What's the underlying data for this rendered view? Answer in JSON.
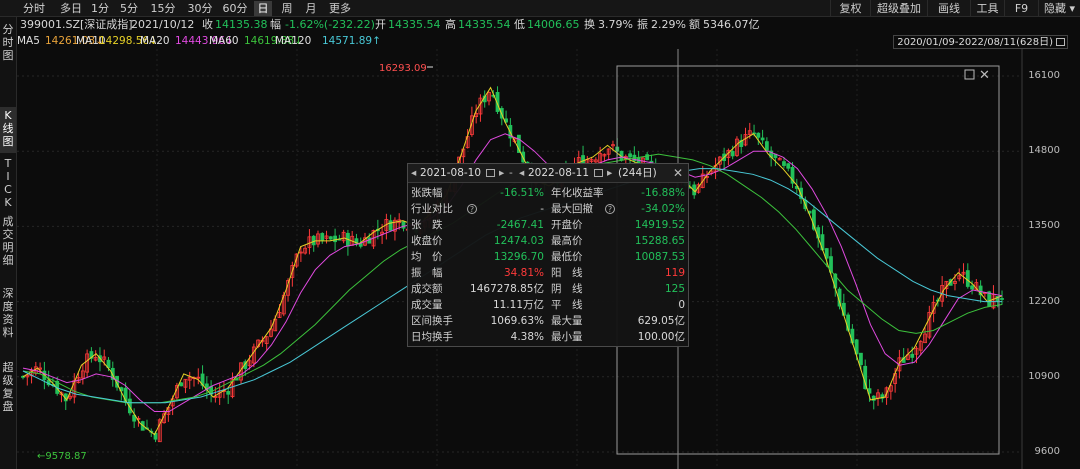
{
  "toolbar": {
    "timeframes": [
      "分时",
      "多日",
      "1分",
      "5分",
      "15分",
      "30分",
      "60分",
      "日",
      "周",
      "月",
      "更多"
    ],
    "active_index": 7,
    "right_buttons": [
      "复权",
      "超级叠加",
      "画线",
      "工具",
      "F9",
      "隐藏"
    ]
  },
  "quote": {
    "code": "399001.SZ[深证成指]",
    "date": "2021/10/12",
    "close_label": "收",
    "close": "14135.38",
    "change_label": "幅",
    "change": "-1.62%(-232.22)",
    "open_label": "开",
    "open": "14335.54",
    "high_label": "高",
    "high": "14335.54",
    "low_label": "低",
    "low": "14006.65",
    "turnover_label": "换",
    "turnover": "3.79%",
    "amplitude_label": "振",
    "amplitude": "2.29%",
    "amount_label": "额",
    "amount": "5346.07亿"
  },
  "left_tabs": [
    "分时图",
    "K线图",
    "TICK",
    "成交明细",
    "深度资料",
    "超级复盘"
  ],
  "left_tab_active": 1,
  "ma": [
    {
      "label": "MA5",
      "value": "14261.03↓",
      "color": "#ffffff",
      "vcolor": "#e8a33a"
    },
    {
      "label": "MA10",
      "value": "14298.56↓",
      "color": "#ffffff",
      "vcolor": "#e6d127"
    },
    {
      "label": "MA20",
      "value": "14443.96↓",
      "color": "#ffffff",
      "vcolor": "#e04ae0"
    },
    {
      "label": "MA60",
      "value": "14619.88↓",
      "color": "#ffffff",
      "vcolor": "#3cc23c"
    },
    {
      "label": "MA120",
      "value": "14571.89↑",
      "color": "#ffffff",
      "vcolor": "#49c8d6"
    }
  ],
  "date_range": "2020/01/09-2022/08/11(628日)",
  "y_axis": [
    "16100",
    "14800",
    "13500",
    "12200",
    "10900",
    "9600"
  ],
  "chart_labels": {
    "high": "16293.09",
    "low": "9578.87"
  },
  "popup": {
    "start": "2021-08-10",
    "end": "2022-08-11",
    "days": "(244日)",
    "rows": [
      {
        "l1": "张跌幅",
        "v1": "-16.51%",
        "c1": "g",
        "l2": "年化收益率",
        "v2": "-16.88%",
        "c2": "g"
      },
      {
        "l1": "行业对比",
        "v1": "-",
        "c1": "w",
        "l2": "最大回撤",
        "v2": "-34.02%",
        "c2": "g"
      },
      {
        "l1": "张　跌",
        "v1": "-2467.41",
        "c1": "g",
        "l2": "开盘价",
        "v2": "14919.52",
        "c2": "g"
      },
      {
        "l1": "收盘价",
        "v1": "12474.03",
        "c1": "g",
        "l2": "最高价",
        "v2": "15288.65",
        "c2": "g"
      },
      {
        "l1": "均　价",
        "v1": "13296.70",
        "c1": "g",
        "l2": "最低价",
        "v2": "10087.53",
        "c2": "g"
      },
      {
        "l1": "振　幅",
        "v1": "34.81%",
        "c1": "r",
        "l2": "阳　线",
        "v2": "119",
        "c2": "r"
      },
      {
        "l1": "成交额",
        "v1": "1467278.85亿",
        "c1": "w",
        "l2": "阴　线",
        "v2": "125",
        "c2": "g"
      },
      {
        "l1": "成交量",
        "v1": "11.11万亿",
        "c1": "w",
        "l2": "平　线",
        "v2": "0",
        "c2": "w"
      },
      {
        "l1": "区间换手",
        "v1": "1069.63%",
        "c1": "w",
        "l2": "最大量",
        "v2": "629.05亿",
        "c2": "w"
      },
      {
        "l1": "日均换手",
        "v1": "4.38%",
        "c1": "w",
        "l2": "最小量",
        "v2": "100.00亿",
        "c2": "w"
      }
    ]
  },
  "colors": {
    "up": "#ff3a3a",
    "down": "#22c05a",
    "ma5": "#e8e8e8",
    "ma10": "#e6d127",
    "ma20": "#e04ae0",
    "ma60": "#3cc23c",
    "ma120": "#49c8d6"
  },
  "chart_data": {
    "type": "line",
    "title": "",
    "y_ticks": [
      16100,
      14800,
      13500,
      12200,
      10900,
      9600
    ],
    "ylim": [
      9400,
      16500
    ],
    "x": [
      "2020/01/09",
      "2022/08/11"
    ],
    "series": [
      {
        "values": [
          10900,
          11050,
          10800,
          10500,
          11100,
          11300,
          11000,
          10500,
          10100,
          9900,
          10400,
          10950,
          10850,
          10550,
          10700,
          11050,
          11400,
          11750,
          12400,
          13150,
          13250,
          13250,
          13300,
          13200,
          13400,
          13550,
          13600,
          13500,
          13750,
          14050,
          14750,
          15500,
          15900,
          15300,
          14800,
          14300,
          14200,
          14350,
          14600,
          14700,
          14900,
          14700,
          14600,
          14500,
          14400,
          14350,
          14100,
          14450,
          14700,
          14950,
          15100,
          14750,
          14500,
          14200,
          13600,
          12900,
          12100,
          11300,
          10500,
          10550,
          11150,
          11400,
          11900,
          12400,
          12700,
          12500,
          12200,
          12300
        ]
      },
      {
        "values": [
          11050,
          11000,
          10900,
          10800,
          10850,
          10950,
          10900,
          10750,
          10500,
          10300,
          10300,
          10450,
          10600,
          10750,
          10850,
          10950,
          11150,
          11450,
          11850,
          12350,
          12750,
          13000,
          13150,
          13200,
          13300,
          13400,
          13500,
          13550,
          13650,
          13850,
          14200,
          14650,
          15000,
          15100,
          15000,
          14800,
          14550,
          14450,
          14450,
          14550,
          14650,
          14700,
          14650,
          14600,
          14550,
          14450,
          14350,
          14400,
          14500,
          14650,
          14800,
          14800,
          14700,
          14500,
          14150,
          13700,
          13150,
          12500,
          11800,
          11300,
          11100,
          11150,
          11450,
          11850,
          12250,
          12400,
          12350,
          12300
        ]
      },
      {
        "values": [
          11000,
          10950,
          10800,
          10650,
          10550,
          10500,
          10450,
          10450,
          10450,
          10500,
          10550,
          10650,
          10800,
          10950,
          11100,
          11300,
          11550,
          11800,
          12100,
          12400,
          12650,
          12900,
          13100,
          13250,
          13400,
          13550,
          13750,
          13950,
          14150,
          14300,
          14400,
          14450,
          14500,
          14550,
          14600,
          14650,
          14700,
          14750,
          14700,
          14650,
          14550,
          14400,
          14200,
          14000,
          13750,
          13450,
          13100,
          12750,
          12400,
          12150,
          11900,
          11700,
          11650,
          11700,
          11850,
          12000,
          12100,
          12150
        ]
      },
      {
        "values": [
          11000,
          10850,
          10700,
          10600,
          10550,
          10500,
          10450,
          10450,
          10450,
          10500,
          10550,
          10650,
          10750,
          10850,
          11000,
          11150,
          11350,
          11550,
          11750,
          11950,
          12150,
          12350,
          12550,
          12750,
          12950,
          13150,
          13350,
          13500,
          13650,
          13750,
          13850,
          13950,
          14050,
          14150,
          14250,
          14350,
          14400,
          14450,
          14500,
          14500,
          14450,
          14400,
          14300,
          14150,
          13950,
          13700,
          13450,
          13200,
          12950,
          12750,
          12550,
          12400,
          12300,
          12250,
          12200,
          12200
        ]
      }
    ]
  }
}
